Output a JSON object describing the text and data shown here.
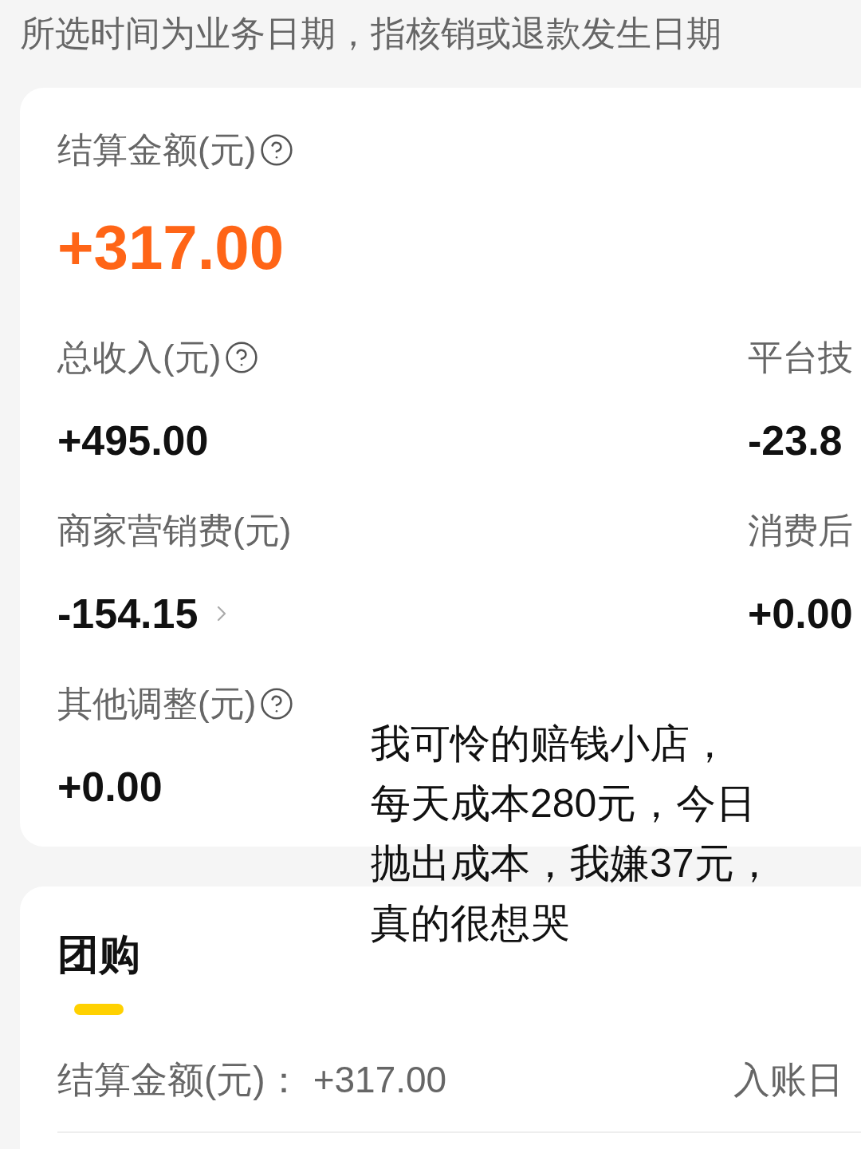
{
  "notice": "所选时间为业务日期，指核销或退款发生日期",
  "summary": {
    "settlement": {
      "label": "结算金额(元)",
      "help": true,
      "value": "+317.00"
    },
    "metrics": [
      {
        "label": "总收入(元)",
        "help": true,
        "value": "+495.00",
        "chevron": false
      },
      {
        "label": "平台技",
        "help": false,
        "value": "-23.8",
        "chevron": false
      },
      {
        "label": "商家营销费(元)",
        "help": false,
        "value": "-154.15",
        "chevron": true
      },
      {
        "label": "消费后",
        "help": false,
        "value": "+0.00",
        "chevron": false
      },
      {
        "label": "其他调整(元)",
        "help": true,
        "value": "+0.00",
        "chevron": false
      }
    ]
  },
  "group_buy": {
    "tabs": [
      {
        "label": "团购",
        "selected": true
      }
    ],
    "settlement": {
      "label": "结算金额(元)：",
      "value": "+317.00"
    },
    "column_2_label": "入账日"
  },
  "annotation": {
    "lines": [
      "我可怜的赔钱小店，",
      "每天成本280元，今日",
      "抛出成本，我嫌37元，",
      "真的很想哭"
    ]
  }
}
